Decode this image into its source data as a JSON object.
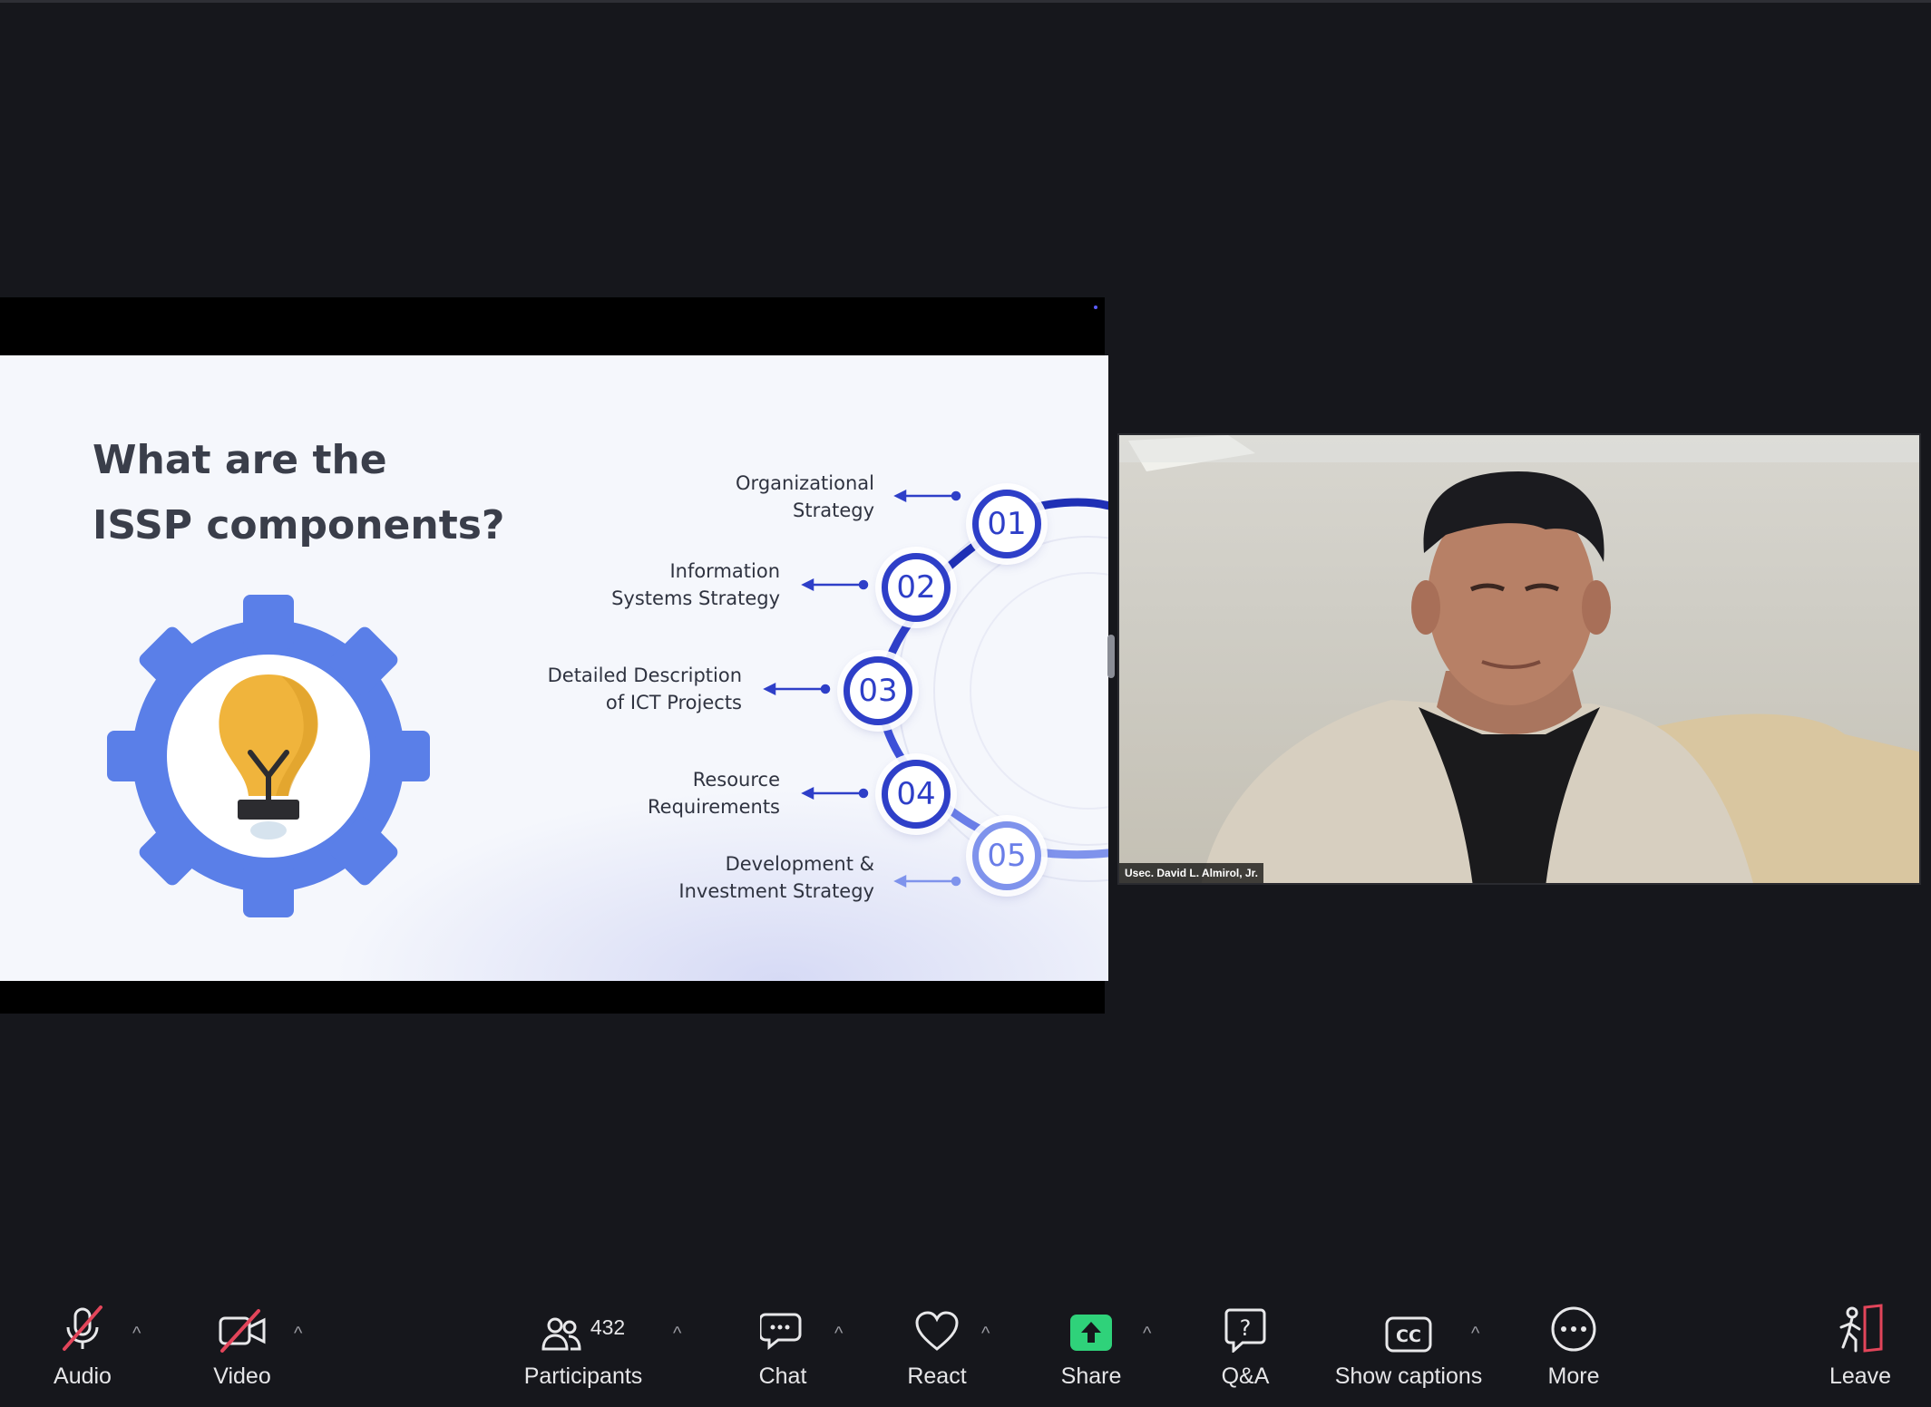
{
  "slide": {
    "title_line1": "What are the",
    "title_line2": "ISSP components?",
    "steps": [
      {
        "num": "01",
        "label": "Organizational\nStrategy"
      },
      {
        "num": "02",
        "label": "Information\nSystems Strategy"
      },
      {
        "num": "03",
        "label": "Detailed Description\nof ICT Projects"
      },
      {
        "num": "04",
        "label": "Resource\nRequirements"
      },
      {
        "num": "05",
        "label": "Development &\nInvestment Strategy"
      }
    ]
  },
  "video": {
    "participant_name": "Usec. David L. Almirol, Jr."
  },
  "toolbar": {
    "audio_label": "Audio",
    "video_label": "Video",
    "participants_label": "Participants",
    "participants_count": "432",
    "chat_label": "Chat",
    "react_label": "React",
    "share_label": "Share",
    "qa_label": "Q&A",
    "captions_label": "Show captions",
    "more_label": "More",
    "leave_label": "Leave",
    "caret": "^"
  },
  "colors": {
    "accent": "#2e3fc8",
    "gear": "#5a7fe8",
    "bulb": "#f0b43c",
    "share_green": "#2fd27a",
    "mute_red": "#e2455a",
    "background": "#16171c"
  }
}
